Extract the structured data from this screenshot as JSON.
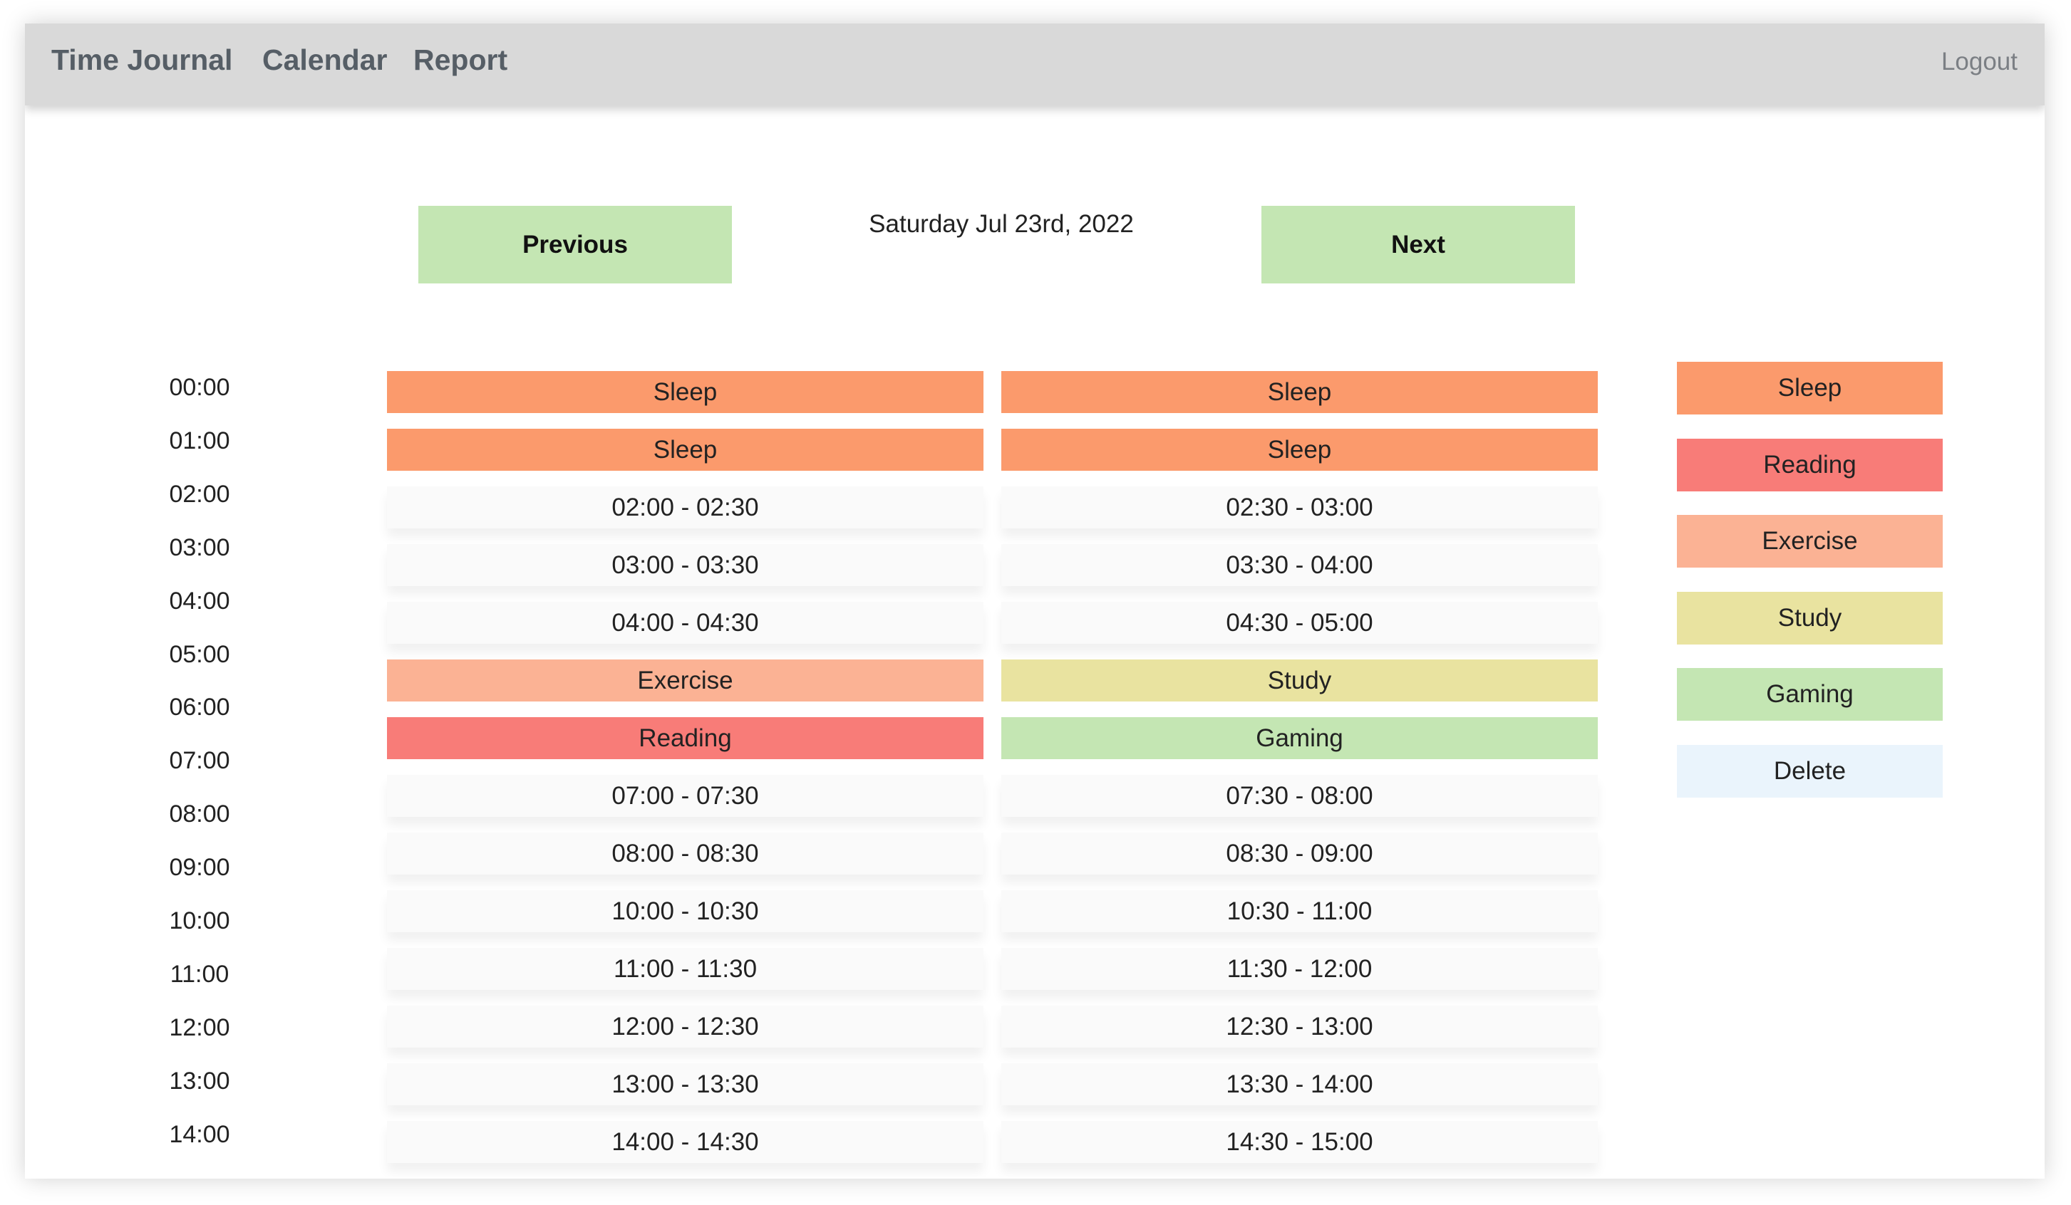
{
  "header": {
    "nav": [
      "Time Journal",
      "Calendar",
      "Report"
    ],
    "logout": "Logout"
  },
  "date_nav": {
    "previous": "Previous",
    "date": "Saturday Jul 23rd, 2022",
    "next": "Next"
  },
  "hour_labels": [
    "00:00",
    "01:00",
    "02:00",
    "03:00",
    "04:00",
    "05:00",
    "06:00",
    "07:00",
    "08:00",
    "09:00",
    "10:00",
    "11:00",
    "12:00",
    "13:00",
    "14:00"
  ],
  "colors": {
    "Sleep": "#fb9a6c",
    "Reading": "#f87c78",
    "Exercise": "#fbb294",
    "Study": "#e9e3a0",
    "Gaming": "#c4e6b3",
    "Delete": "#eaf4fc"
  },
  "schedule": [
    [
      "Sleep",
      "Sleep"
    ],
    [
      "Sleep",
      "Sleep"
    ],
    [
      "02:00 - 02:30",
      "02:30 - 03:00"
    ],
    [
      "03:00 - 03:30",
      "03:30 - 04:00"
    ],
    [
      "04:00 - 04:30",
      "04:30 - 05:00"
    ],
    [
      "Exercise",
      "Study"
    ],
    [
      "Reading",
      "Gaming"
    ],
    [
      "07:00 - 07:30",
      "07:30 - 08:00"
    ],
    [
      "08:00 - 08:30",
      "08:30 - 09:00"
    ],
    [
      "10:00 - 10:30",
      "10:30 - 11:00"
    ],
    [
      "11:00 - 11:30",
      "11:30 - 12:00"
    ],
    [
      "12:00 - 12:30",
      "12:30 - 13:00"
    ],
    [
      "13:00 - 13:30",
      "13:30 - 14:00"
    ],
    [
      "14:00 - 14:30",
      "14:30 - 15:00"
    ]
  ],
  "legend": [
    "Sleep",
    "Reading",
    "Exercise",
    "Study",
    "Gaming",
    "Delete"
  ]
}
